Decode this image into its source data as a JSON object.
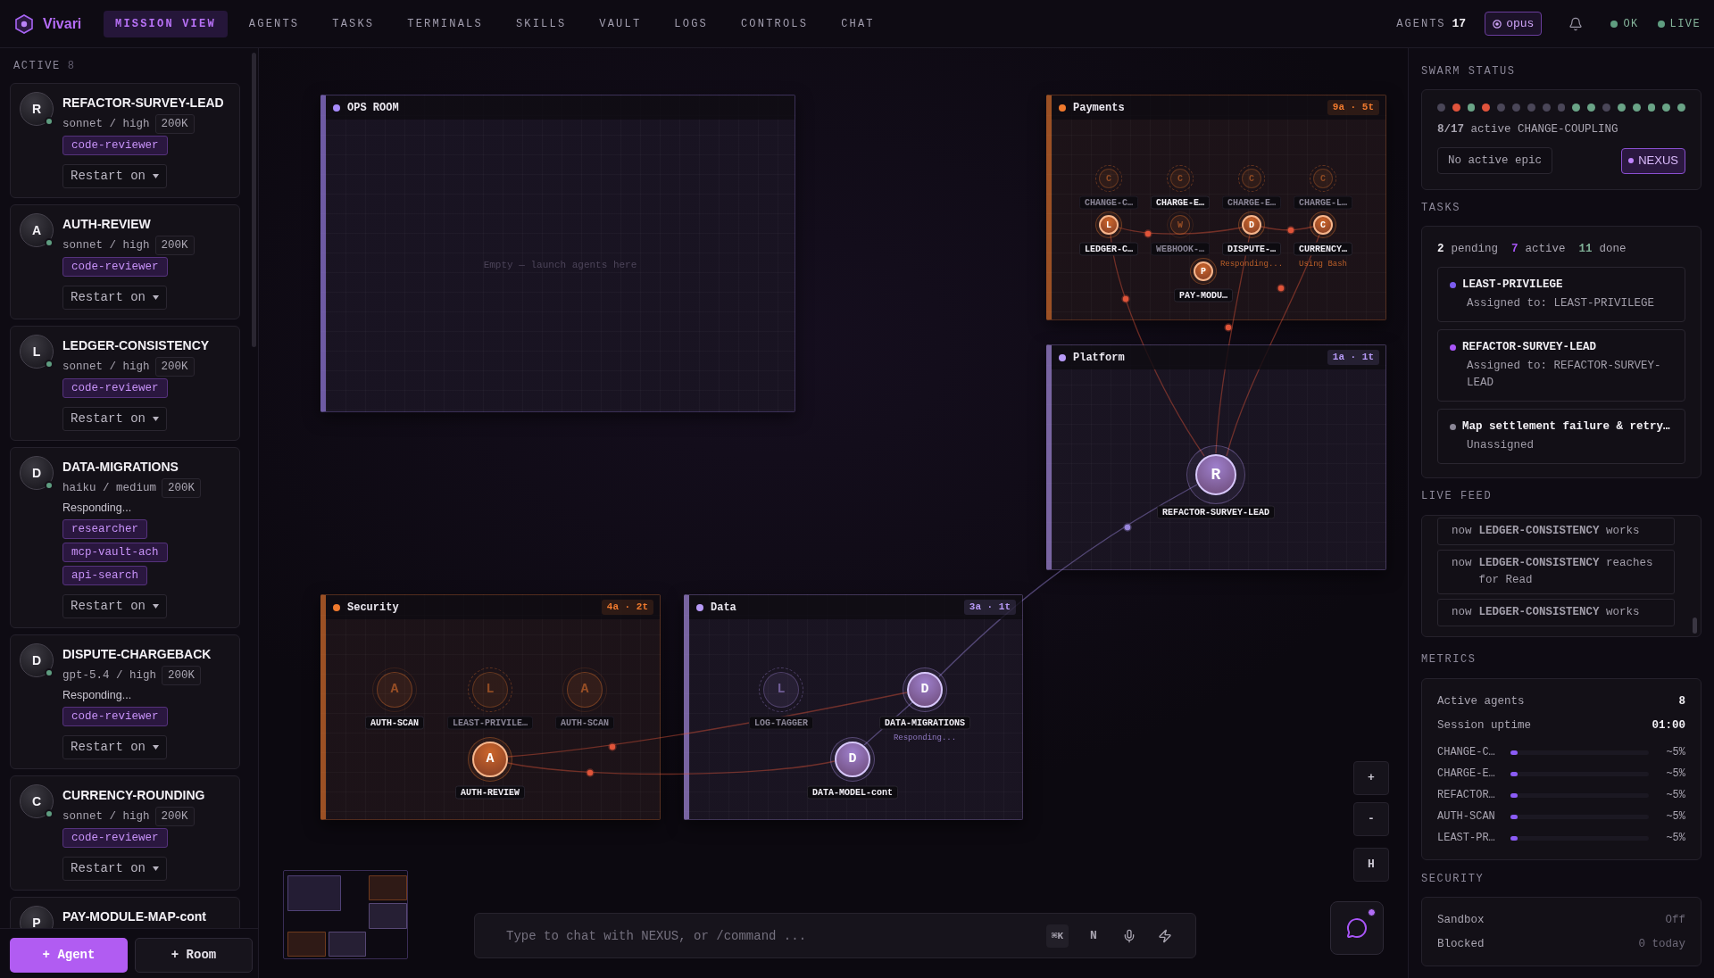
{
  "brand": {
    "name": "Vivari"
  },
  "nav": {
    "tabs": [
      {
        "label": "MISSION VIEW",
        "selected": true
      },
      {
        "label": "AGENTS",
        "selected": false
      },
      {
        "label": "TASKS",
        "selected": false
      },
      {
        "label": "TERMINALS",
        "selected": false
      },
      {
        "label": "SKILLS",
        "selected": false
      },
      {
        "label": "VAULT",
        "selected": false
      },
      {
        "label": "LOGS",
        "selected": false
      },
      {
        "label": "CONTROLS",
        "selected": false
      },
      {
        "label": "CHAT",
        "selected": false
      }
    ]
  },
  "header": {
    "agents_label": "AGENTS",
    "agents_count": "17",
    "model": "opus",
    "indicators": [
      {
        "label": "OK",
        "color": "#5f9d80"
      },
      {
        "label": "LIVE",
        "color": "#5f9d80"
      }
    ]
  },
  "sidebar": {
    "heading": "ACTIVE",
    "count": "8",
    "agents": [
      {
        "initial": "R",
        "name": "REFACTOR-SURVEY-LEAD",
        "online": true,
        "model": "sonnet / high",
        "context": "200K",
        "tags": [
          "code-reviewer"
        ],
        "restart": "Restart on"
      },
      {
        "initial": "A",
        "name": "AUTH-REVIEW",
        "online": true,
        "model": "sonnet / high",
        "context": "200K",
        "tags": [
          "code-reviewer"
        ],
        "restart": "Restart on"
      },
      {
        "initial": "L",
        "name": "LEDGER-CONSISTENCY",
        "online": true,
        "model": "sonnet / high",
        "context": "200K",
        "tags": [
          "code-reviewer"
        ],
        "restart": "Restart on"
      },
      {
        "initial": "D",
        "name": "DATA-MIGRATIONS",
        "online": true,
        "model": "haiku / medium",
        "context": "200K",
        "status": "Responding...",
        "tags": [
          "researcher",
          "mcp-vault-ach",
          "api-search"
        ],
        "restart": "Restart on"
      },
      {
        "initial": "D",
        "name": "DISPUTE-CHARGEBACK",
        "online": true,
        "model": "gpt-5.4 / high",
        "context": "200K",
        "status": "Responding...",
        "tags": [
          "code-reviewer"
        ],
        "restart": "Restart on"
      },
      {
        "initial": "C",
        "name": "CURRENCY-ROUNDING",
        "online": true,
        "model": "sonnet / high",
        "context": "200K",
        "tags": [
          "code-reviewer"
        ],
        "restart": "Restart on"
      },
      {
        "initial": "P",
        "name": "PAY-MODULE-MAP-cont"
      }
    ],
    "buttons": [
      {
        "label": "+ Agent",
        "kind": "primary"
      },
      {
        "label": "+ Room",
        "kind": "secondary"
      }
    ]
  },
  "canvas": {
    "rooms": [
      {
        "name": "OPS ROOM",
        "color": "#a78bfa",
        "empty_text": "Empty — launch agents here"
      },
      {
        "name": "Payments",
        "color": "#f07a2e",
        "badge": "9a · 5t",
        "nodes": [
          {
            "initial": "C",
            "label": "CHANGE-C…",
            "kind": "queued",
            "label_highlighted": false
          },
          {
            "initial": "C",
            "label": "CHARGE-E…",
            "kind": "queued",
            "label_highlighted": true
          },
          {
            "initial": "C",
            "label": "CHARGE-E…",
            "kind": "queued",
            "label_highlighted": false
          },
          {
            "initial": "C",
            "label": "CHARGE-L…",
            "kind": "queued",
            "label_highlighted": false
          },
          {
            "initial": "L",
            "label": "LEDGER-C…",
            "kind": "active",
            "label_highlighted": true
          },
          {
            "initial": "W",
            "label": "WEBHOOK-…",
            "kind": "idle",
            "label_highlighted": false
          },
          {
            "initial": "D",
            "label": "DISPUTE-…",
            "kind": "active",
            "label_highlighted": true,
            "note": "Responding..."
          },
          {
            "initial": "C",
            "label": "CURRENCY…",
            "kind": "active",
            "label_highlighted": true,
            "note": "Using Bash"
          },
          {
            "initial": "P",
            "label": "PAY-MODU…",
            "kind": "active",
            "label_highlighted": true
          }
        ]
      },
      {
        "name": "Platform",
        "color": "#b79af7",
        "badge": "1a · 1t",
        "nodes": [
          {
            "initial": "R",
            "label": "REFACTOR-SURVEY-LEAD",
            "kind": "active",
            "label_highlighted": true
          }
        ]
      },
      {
        "name": "Security",
        "color": "#f07a2e",
        "badge": "4a · 2t",
        "nodes": [
          {
            "initial": "A",
            "label": "AUTH-SCAN",
            "kind": "idle",
            "label_highlighted": true
          },
          {
            "initial": "L",
            "label": "LEAST-PRIVILE…",
            "kind": "queued",
            "label_highlighted": false
          },
          {
            "initial": "A",
            "label": "AUTH-SCAN",
            "kind": "idle",
            "label_highlighted": false
          },
          {
            "initial": "A",
            "label": "AUTH-REVIEW",
            "kind": "active",
            "label_highlighted": true
          }
        ]
      },
      {
        "name": "Data",
        "color": "#b79af7",
        "badge": "3a · 1t",
        "nodes": [
          {
            "initial": "L",
            "label": "LOG-TAGGER",
            "kind": "queued",
            "label_highlighted": false
          },
          {
            "initial": "D",
            "label": "DATA-MIGRATIONS",
            "kind": "active",
            "label_highlighted": true,
            "note": "Responding..."
          },
          {
            "initial": "D",
            "label": "DATA-MODEL-cont",
            "kind": "active",
            "label_highlighted": true
          }
        ]
      }
    ],
    "zoom_controls": [
      "+",
      "-",
      "H"
    ],
    "chat": {
      "placeholder": "Type to chat with NEXUS, or /command ...",
      "shortcut": "⌘K",
      "mode": "N"
    }
  },
  "right_panel": {
    "swarm": {
      "title": "SWARM STATUS",
      "dots": [
        {
          "color": "#4a4658"
        },
        {
          "color": "#e0533c"
        },
        {
          "color": "#6aa487"
        },
        {
          "color": "#e0533c"
        },
        {
          "color": "#4a4658"
        },
        {
          "color": "#4a4658"
        },
        {
          "color": "#4a4658"
        },
        {
          "color": "#4a4658"
        },
        {
          "color": "#4a4658"
        },
        {
          "color": "#6aa487"
        },
        {
          "color": "#6aa487"
        },
        {
          "color": "#4a4658"
        },
        {
          "color": "#6aa487"
        },
        {
          "color": "#6aa487"
        },
        {
          "color": "#6aa487"
        },
        {
          "color": "#6aa487"
        },
        {
          "color": "#6aa487"
        }
      ],
      "summary": "**8/17** active CHANGE-COUPLING",
      "epic": "No active epic",
      "orchestrator": "NEXUS"
    },
    "tasks": {
      "title": "TASKS",
      "counts": [
        {
          "number": "2",
          "word": "pending",
          "color": "#f2f0f5"
        },
        {
          "number": "7",
          "word": "active",
          "color": "#a855f7"
        },
        {
          "number": "11",
          "word": "done",
          "color": "#7fae95"
        }
      ],
      "items": [
        {
          "title": "LEAST-PRIVILEGE",
          "assignee": "Assigned to: LEAST-PRIVILEGE",
          "color": "#7c5cf0"
        },
        {
          "title": "REFACTOR-SURVEY-LEAD",
          "assignee": "Assigned to: REFACTOR-SURVEY-LEAD",
          "color": "#a855f7"
        },
        {
          "title": "Map settlement failure & retry…",
          "assignee": "Unassigned",
          "color": "#8a8696"
        }
      ]
    },
    "live_feed": {
      "title": "LIVE FEED",
      "items": [
        {
          "time": "now",
          "text": "**LEDGER-CONSISTENCY** works"
        },
        {
          "time": "now",
          "text": "**LEDGER-CONSISTENCY** reaches for Read"
        },
        {
          "time": "now",
          "text": "**LEDGER-CONSISTENCY** works"
        }
      ]
    },
    "metrics": {
      "title": "METRICS",
      "stats": [
        {
          "label": "Active agents",
          "value": "8"
        },
        {
          "label": "Session uptime",
          "value": "01:00"
        }
      ],
      "bars": [
        {
          "label": "CHANGE-C…",
          "level": 0.05,
          "reading": "~5%"
        },
        {
          "label": "CHARGE-E…",
          "level": 0.05,
          "reading": "~5%"
        },
        {
          "label": "REFACTOR…",
          "level": 0.05,
          "reading": "~5%"
        },
        {
          "label": "AUTH-SCAN",
          "level": 0.05,
          "reading": "~5%"
        },
        {
          "label": "LEAST-PR…",
          "level": 0.05,
          "reading": "~5%"
        }
      ]
    },
    "security": {
      "title": "SECURITY",
      "rows": [
        {
          "label": "Sandbox",
          "value": "Off"
        },
        {
          "label": "Blocked",
          "value": "0 today"
        }
      ]
    }
  }
}
